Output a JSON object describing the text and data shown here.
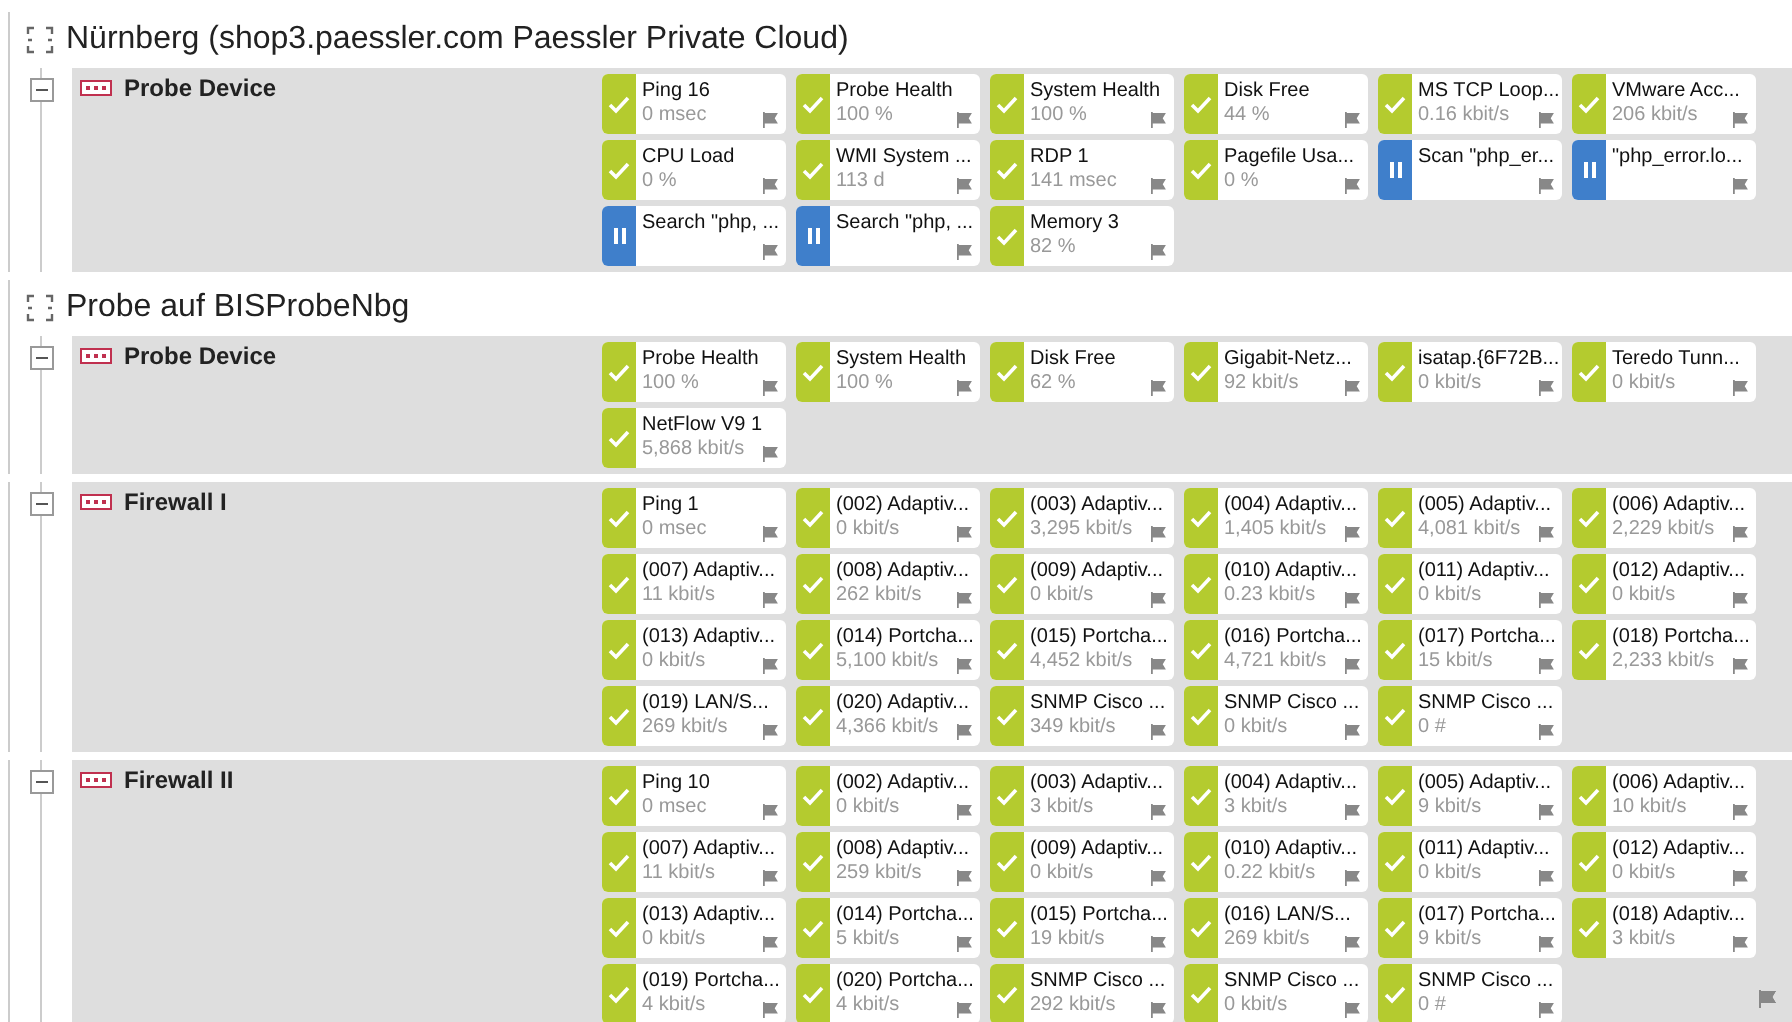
{
  "groups": [
    {
      "title": "Nürnberg (shop3.paessler.com Paessler Private Cloud)",
      "devices": [
        {
          "name": "Probe Device",
          "sensors": [
            {
              "kind": "up",
              "name": "Ping 16",
              "value": "0 msec"
            },
            {
              "kind": "up",
              "name": "Probe Health",
              "value": "100 %"
            },
            {
              "kind": "up",
              "name": "System Health",
              "value": "100 %"
            },
            {
              "kind": "up",
              "name": "Disk Free",
              "value": "44 %"
            },
            {
              "kind": "up",
              "name": "MS TCP Loop...",
              "value": "0.16 kbit/s"
            },
            {
              "kind": "up",
              "name": "VMware Acc...",
              "value": "206 kbit/s"
            },
            {
              "kind": "up",
              "name": "CPU Load",
              "value": "0 %"
            },
            {
              "kind": "up",
              "name": "WMI System ...",
              "value": "113 d"
            },
            {
              "kind": "up",
              "name": "RDP 1",
              "value": "141 msec"
            },
            {
              "kind": "up",
              "name": "Pagefile Usa...",
              "value": "0 %"
            },
            {
              "kind": "paused",
              "name": "Scan \"php_er..."
            },
            {
              "kind": "paused",
              "name": "\"php_error.lo..."
            },
            {
              "kind": "paused",
              "name": "Search \"php, ..."
            },
            {
              "kind": "paused",
              "name": "Search \"php, ..."
            },
            {
              "kind": "up",
              "name": "Memory 3",
              "value": "82 %"
            }
          ]
        }
      ]
    },
    {
      "title": "Probe auf BISProbeNbg",
      "devices": [
        {
          "name": "Probe Device",
          "sensors": [
            {
              "kind": "up",
              "name": "Probe Health",
              "value": "100 %"
            },
            {
              "kind": "up",
              "name": "System Health",
              "value": "100 %"
            },
            {
              "kind": "up",
              "name": "Disk Free",
              "value": "62 %"
            },
            {
              "kind": "up",
              "name": "Gigabit-Netz...",
              "value": "92 kbit/s"
            },
            {
              "kind": "up",
              "name": "isatap.{6F72B...",
              "value": "0 kbit/s"
            },
            {
              "kind": "up",
              "name": "Teredo Tunn...",
              "value": "0 kbit/s"
            },
            {
              "kind": "up",
              "name": "NetFlow V9 1",
              "value": "5,868 kbit/s"
            }
          ]
        },
        {
          "name": "Firewall I",
          "sensors": [
            {
              "kind": "up",
              "name": "Ping 1",
              "value": "0 msec"
            },
            {
              "kind": "up",
              "name": "(002) Adaptiv...",
              "value": "0 kbit/s"
            },
            {
              "kind": "up",
              "name": "(003) Adaptiv...",
              "value": "3,295 kbit/s"
            },
            {
              "kind": "up",
              "name": "(004) Adaptiv...",
              "value": "1,405 kbit/s"
            },
            {
              "kind": "up",
              "name": "(005) Adaptiv...",
              "value": "4,081 kbit/s"
            },
            {
              "kind": "up",
              "name": "(006) Adaptiv...",
              "value": "2,229 kbit/s"
            },
            {
              "kind": "up",
              "name": "(007) Adaptiv...",
              "value": "11 kbit/s"
            },
            {
              "kind": "up",
              "name": "(008) Adaptiv...",
              "value": "262 kbit/s"
            },
            {
              "kind": "up",
              "name": "(009) Adaptiv...",
              "value": "0 kbit/s"
            },
            {
              "kind": "up",
              "name": "(010) Adaptiv...",
              "value": "0.23 kbit/s"
            },
            {
              "kind": "up",
              "name": "(011) Adaptiv...",
              "value": "0 kbit/s"
            },
            {
              "kind": "up",
              "name": "(012) Adaptiv...",
              "value": "0 kbit/s"
            },
            {
              "kind": "up",
              "name": "(013) Adaptiv...",
              "value": "0 kbit/s"
            },
            {
              "kind": "up",
              "name": "(014) Portcha...",
              "value": "5,100 kbit/s"
            },
            {
              "kind": "up",
              "name": "(015) Portcha...",
              "value": "4,452 kbit/s"
            },
            {
              "kind": "up",
              "name": "(016) Portcha...",
              "value": "4,721 kbit/s"
            },
            {
              "kind": "up",
              "name": "(017) Portcha...",
              "value": "15 kbit/s"
            },
            {
              "kind": "up",
              "name": "(018) Portcha...",
              "value": "2,233 kbit/s"
            },
            {
              "kind": "up",
              "name": "(019) LAN/S...",
              "value": "269 kbit/s"
            },
            {
              "kind": "up",
              "name": "(020) Adaptiv...",
              "value": "4,366 kbit/s"
            },
            {
              "kind": "up",
              "name": "SNMP Cisco ...",
              "value": "349 kbit/s"
            },
            {
              "kind": "up",
              "name": "SNMP Cisco ...",
              "value": "0 kbit/s"
            },
            {
              "kind": "up",
              "name": "SNMP Cisco ...",
              "value": "0 #"
            }
          ]
        },
        {
          "name": "Firewall II",
          "sensors": [
            {
              "kind": "up",
              "name": "Ping 10",
              "value": "0 msec"
            },
            {
              "kind": "up",
              "name": "(002) Adaptiv...",
              "value": "0 kbit/s"
            },
            {
              "kind": "up",
              "name": "(003) Adaptiv...",
              "value": "3 kbit/s"
            },
            {
              "kind": "up",
              "name": "(004) Adaptiv...",
              "value": "3 kbit/s"
            },
            {
              "kind": "up",
              "name": "(005) Adaptiv...",
              "value": "9 kbit/s"
            },
            {
              "kind": "up",
              "name": "(006) Adaptiv...",
              "value": "10 kbit/s"
            },
            {
              "kind": "up",
              "name": "(007) Adaptiv...",
              "value": "11 kbit/s"
            },
            {
              "kind": "up",
              "name": "(008) Adaptiv...",
              "value": "259 kbit/s"
            },
            {
              "kind": "up",
              "name": "(009) Adaptiv...",
              "value": "0 kbit/s"
            },
            {
              "kind": "up",
              "name": "(010) Adaptiv...",
              "value": "0.22 kbit/s"
            },
            {
              "kind": "up",
              "name": "(011) Adaptiv...",
              "value": "0 kbit/s"
            },
            {
              "kind": "up",
              "name": "(012) Adaptiv...",
              "value": "0 kbit/s"
            },
            {
              "kind": "up",
              "name": "(013) Adaptiv...",
              "value": "0 kbit/s"
            },
            {
              "kind": "up",
              "name": "(014) Portcha...",
              "value": "5 kbit/s"
            },
            {
              "kind": "up",
              "name": "(015) Portcha...",
              "value": "19 kbit/s"
            },
            {
              "kind": "up",
              "name": "(016) LAN/S...",
              "value": "269 kbit/s"
            },
            {
              "kind": "up",
              "name": "(017) Portcha...",
              "value": "9 kbit/s"
            },
            {
              "kind": "up",
              "name": "(018) Adaptiv...",
              "value": "3 kbit/s"
            },
            {
              "kind": "up",
              "name": "(019) Portcha...",
              "value": "4 kbit/s"
            },
            {
              "kind": "up",
              "name": "(020) Portcha...",
              "value": "4 kbit/s"
            },
            {
              "kind": "up",
              "name": "SNMP Cisco ...",
              "value": "292 kbit/s"
            },
            {
              "kind": "up",
              "name": "SNMP Cisco ...",
              "value": "0 kbit/s"
            },
            {
              "kind": "up",
              "name": "SNMP Cisco ...",
              "value": "0 #"
            }
          ]
        }
      ]
    }
  ]
}
